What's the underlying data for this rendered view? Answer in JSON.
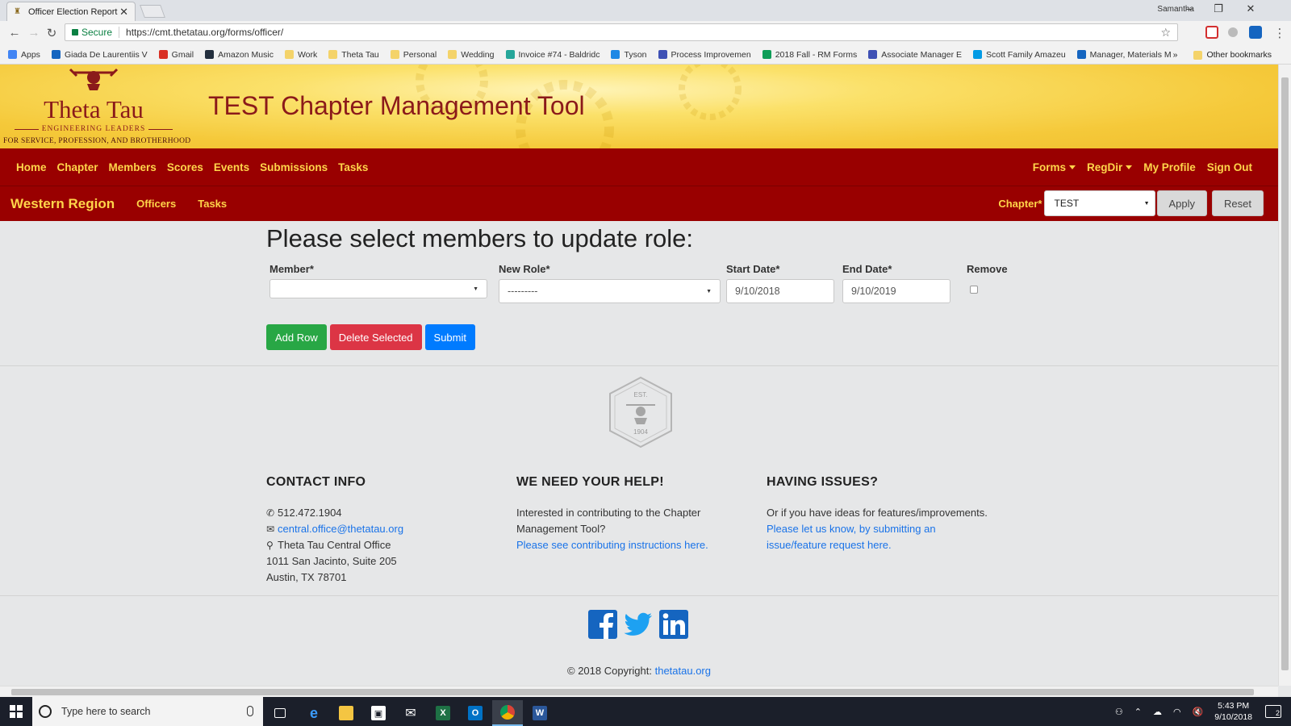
{
  "browser": {
    "tab_title": "Officer Election Report",
    "tab_close": "✕",
    "profile": "Samantha",
    "secure_label": "Secure",
    "url": "https://cmt.thetatau.org/forms/officer/",
    "bookmarks": [
      {
        "label": "Apps",
        "icon": "apps-grid-icon",
        "color": "#4285f4"
      },
      {
        "label": "Giada De Laurentiis V",
        "icon": "site-icon",
        "color": "#1565c0"
      },
      {
        "label": "Gmail",
        "icon": "gmail-icon",
        "color": "#d93025"
      },
      {
        "label": "Amazon Music",
        "icon": "amazon-icon",
        "color": "#232f3e"
      },
      {
        "label": "Work",
        "icon": "folder-icon",
        "color": "#f4d36a"
      },
      {
        "label": "Theta Tau",
        "icon": "folder-icon",
        "color": "#f4d36a"
      },
      {
        "label": "Personal",
        "icon": "folder-icon",
        "color": "#f4d36a"
      },
      {
        "label": "Wedding",
        "icon": "folder-icon",
        "color": "#f4d36a"
      },
      {
        "label": "Invoice #74 - Baldridc",
        "icon": "site-icon",
        "color": "#26a69a"
      },
      {
        "label": "Tyson",
        "icon": "site-icon",
        "color": "#1e88e5"
      },
      {
        "label": "Process Improvemen",
        "icon": "site-icon",
        "color": "#3f51b5"
      },
      {
        "label": "2018 Fall - RM Forms",
        "icon": "sheets-icon",
        "color": "#0f9d58"
      },
      {
        "label": "Associate Manager E",
        "icon": "site-icon",
        "color": "#3f51b5"
      },
      {
        "label": "Scott Family Amazeu",
        "icon": "site-icon",
        "color": "#039be5"
      },
      {
        "label": "Manager, Materials M",
        "icon": "site-icon",
        "color": "#1565c0"
      }
    ],
    "bookmarks_overflow": "»",
    "other_bookmarks": "Other bookmarks"
  },
  "site": {
    "brand": "Theta Tau",
    "tagline1": "ENGINEERING LEADERS",
    "tagline2": "FOR SERVICE, PROFESSION, AND BROTHERHOOD",
    "title": "TEST Chapter Management Tool"
  },
  "nav": {
    "items": [
      "Home",
      "Chapter",
      "Members",
      "Scores",
      "Events",
      "Submissions",
      "Tasks"
    ],
    "right": {
      "forms": "Forms",
      "regdir": "RegDir",
      "profile": "My Profile",
      "signout": "Sign Out"
    }
  },
  "subnav": {
    "region": "Western Region",
    "officers": "Officers",
    "tasks": "Tasks",
    "chapter_label": "Chapter*",
    "chapter_value": "TEST",
    "apply": "Apply",
    "reset": "Reset"
  },
  "form": {
    "heading": "Please select members to update role:",
    "headers": {
      "member": "Member*",
      "role": "New Role*",
      "start": "Start Date*",
      "end": "End Date*",
      "remove": "Remove"
    },
    "row": {
      "member": "",
      "role": "---------",
      "start": "9/10/2018",
      "end": "9/10/2019"
    },
    "buttons": {
      "add": "Add Row",
      "delete": "Delete Selected",
      "submit": "Submit"
    }
  },
  "emblem": {
    "top": "EST.",
    "year": "1904"
  },
  "footer": {
    "contact": {
      "heading": "CONTACT INFO",
      "phone": "512.472.1904",
      "email": "central.office@thetatau.org",
      "office": "Theta Tau Central Office",
      "street": "1011 San Jacinto, Suite 205",
      "city": "Austin, TX 78701"
    },
    "help": {
      "heading": "WE NEED YOUR HELP!",
      "text": "Interested in contributing to the Chapter Management Tool?",
      "link": "Please see contributing instructions here."
    },
    "issues": {
      "heading": "HAVING ISSUES?",
      "text": "Or if you have ideas for features/improvements.",
      "link": "Please let us know, by submitting an issue/feature request here."
    },
    "copyright": "© 2018 Copyright:",
    "copyright_link": "thetatau.org"
  },
  "taskbar": {
    "search_placeholder": "Type here to search",
    "time": "5:43 PM",
    "date": "9/10/2018",
    "notifications": "2"
  },
  "colors": {
    "primary": "#990000",
    "accent": "#ffd54a",
    "banner": "#f5c93a",
    "link": "#1a73e8"
  }
}
